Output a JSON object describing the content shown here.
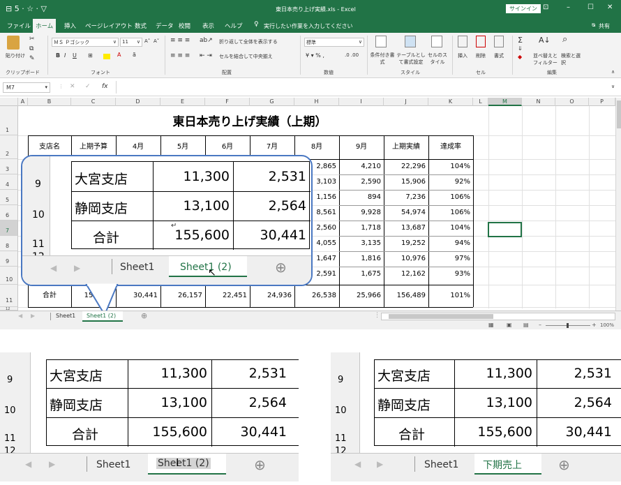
{
  "titlebar": {
    "quick_access": "⊟ 5 · ☆ · ▽",
    "file_title": "東日本売り上げ実績.xls  -  Excel",
    "signin": "サインイン",
    "win_buttons": [
      "⊡",
      "–",
      "☐",
      "✕"
    ]
  },
  "ribbon_tabs": [
    "ファイル",
    "ホーム",
    "挿入",
    "ページレイアウト",
    "数式",
    "データ",
    "校閲",
    "表示",
    "ヘルプ"
  ],
  "tell_me": "実行したい作業を入力してください",
  "share": "共有",
  "ribbon": {
    "paste": "貼り付け",
    "clipboard_label": "クリップボード",
    "font_name": "ＭＳ Ｐゴシック",
    "font_size": "11",
    "font_label": "フォント",
    "wrap_text": "折り返して全体を表示する",
    "merge_center": "セルを結合して中央揃え",
    "align_label": "配置",
    "number_format": "標準",
    "number_label": "数値",
    "cond_format": "条件付き書式",
    "table_format": "テーブルとして書式設定",
    "cell_style": "セルのスタイル",
    "style_label": "スタイル",
    "insert": "挿入",
    "delete": "削除",
    "format": "書式",
    "cells_label": "セル",
    "sort_filter": "並べ替えとフィルター",
    "find_select": "検索と選択",
    "edit_label": "編集"
  },
  "formula_bar": {
    "name_box": "M7",
    "fx": "fx",
    "content": ""
  },
  "columns": [
    "A",
    "B",
    "C",
    "D",
    "E",
    "F",
    "G",
    "H",
    "I",
    "J",
    "K",
    "L",
    "M",
    "N",
    "O",
    "P"
  ],
  "rows": [
    "1",
    "2",
    "3",
    "4",
    "5",
    "6",
    "7",
    "8",
    "9",
    "10",
    "11",
    "12"
  ],
  "sheet_title": "東日本売り上げ実績（上期）",
  "table_headers": [
    "支店名",
    "上期予算",
    "4月",
    "5月",
    "6月",
    "7月",
    "8月",
    "9月",
    "上期実績",
    "達成率"
  ],
  "table_rows": [
    [
      "2,865",
      "4,210",
      "22,296",
      "104%"
    ],
    [
      "3,103",
      "2,590",
      "15,906",
      "92%"
    ],
    [
      "1,156",
      "894",
      "7,236",
      "106%"
    ],
    [
      "8,561",
      "9,928",
      "54,974",
      "106%"
    ],
    [
      "2,560",
      "1,718",
      "13,687",
      "104%"
    ],
    [
      "4,055",
      "3,135",
      "19,252",
      "94%"
    ],
    [
      "1,647",
      "1,816",
      "10,976",
      "97%"
    ],
    [
      "2,591",
      "1,675",
      "12,162",
      "93%"
    ]
  ],
  "total_row": [
    "合計",
    "155,600",
    "30,441",
    "26,157",
    "22,451",
    "24,936",
    "26,538",
    "25,966",
    "156,489",
    "101%"
  ],
  "sheet_tabs": [
    "Sheet1",
    "Sheet1 (2)"
  ],
  "status": {
    "zoom": "100%"
  },
  "callout": {
    "rows": [
      {
        "num": "9",
        "name": "大宮支店",
        "v1": "11,300",
        "v2": "2,531"
      },
      {
        "num": "10",
        "name": "静岡支店",
        "v1": "13,100",
        "v2": "2,564"
      },
      {
        "num": "11",
        "name": "合計",
        "v1": "155,600",
        "v2": "30,441"
      }
    ],
    "row12": "12",
    "tab1": "Sheet1",
    "tab2": "Sheet1 (2)",
    "add_tab": "⊕"
  },
  "panel_left": {
    "tab1": "Sheet1",
    "tab2": "Sheet1 (2)",
    "add_tab": "⊕"
  },
  "panel_right": {
    "tab1": "Sheet1",
    "tab2": "下期売上",
    "add_tab": "⊕"
  },
  "colors": {
    "excel_green": "#217346",
    "callout_blue": "#4a78c2",
    "tab_green": "#217346"
  }
}
